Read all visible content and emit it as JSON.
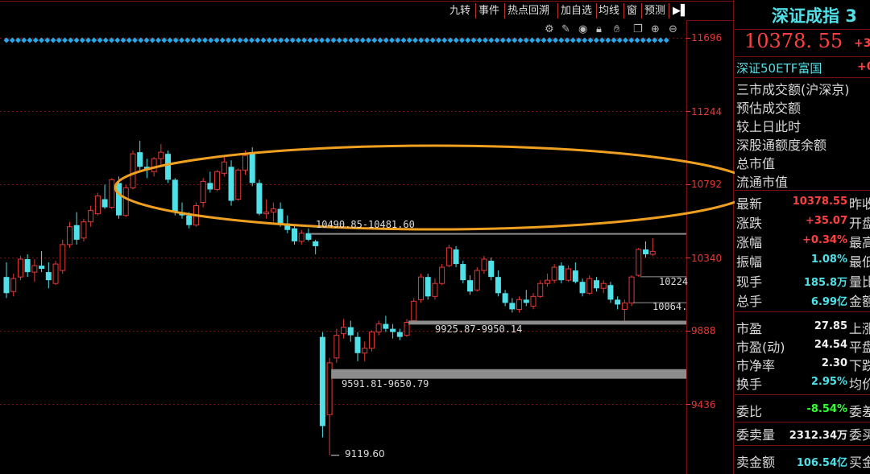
{
  "toolbar": {
    "items": [
      "九转",
      "事件",
      "热点回溯",
      "加自选",
      "均线",
      "窗",
      "预测"
    ],
    "collapse_icon": "collapse-right-icon",
    "icons": [
      "settings-icon",
      "pen-icon",
      "eye-icon",
      "lock-icon",
      "hand-icon",
      "copy-icon",
      "zoom-in-icon",
      "zoom-out-icon"
    ]
  },
  "colors": {
    "up": "#e53935",
    "down": "#4fe0e8",
    "grid": "#7a1111",
    "ellipse": "#f0a020",
    "value_red": "#ff4040",
    "value_green": "#33ff33",
    "value_cyan": "#4fe0e8",
    "title_cyan": "#4fe0e8"
  },
  "chart_data": {
    "type": "candlestick",
    "y_ticks": [
      11696,
      11244,
      10792,
      10340,
      9888,
      9436
    ],
    "ylim": [
      9030,
      11770
    ],
    "grid": true,
    "candles": [
      {
        "o": 10220,
        "h": 10310,
        "l": 10090,
        "c": 10120
      },
      {
        "o": 10130,
        "h": 10240,
        "l": 10100,
        "c": 10210
      },
      {
        "o": 10220,
        "h": 10350,
        "l": 10200,
        "c": 10330
      },
      {
        "o": 10330,
        "h": 10360,
        "l": 10220,
        "c": 10250
      },
      {
        "o": 10250,
        "h": 10330,
        "l": 10190,
        "c": 10290
      },
      {
        "o": 10290,
        "h": 10380,
        "l": 10250,
        "c": 10270
      },
      {
        "o": 10250,
        "h": 10310,
        "l": 10150,
        "c": 10200
      },
      {
        "o": 10180,
        "h": 10320,
        "l": 10170,
        "c": 10300
      },
      {
        "o": 10260,
        "h": 10450,
        "l": 10240,
        "c": 10420
      },
      {
        "o": 10420,
        "h": 10560,
        "l": 10400,
        "c": 10530
      },
      {
        "o": 10540,
        "h": 10620,
        "l": 10420,
        "c": 10450
      },
      {
        "o": 10460,
        "h": 10580,
        "l": 10440,
        "c": 10560
      },
      {
        "o": 10560,
        "h": 10660,
        "l": 10530,
        "c": 10630
      },
      {
        "o": 10610,
        "h": 10740,
        "l": 10600,
        "c": 10720
      },
      {
        "o": 10700,
        "h": 10790,
        "l": 10640,
        "c": 10650
      },
      {
        "o": 10650,
        "h": 10830,
        "l": 10640,
        "c": 10820
      },
      {
        "o": 10800,
        "h": 10840,
        "l": 10580,
        "c": 10600
      },
      {
        "o": 10600,
        "h": 10790,
        "l": 10590,
        "c": 10770
      },
      {
        "o": 10770,
        "h": 11000,
        "l": 10760,
        "c": 10980
      },
      {
        "o": 10990,
        "h": 11060,
        "l": 10880,
        "c": 10900
      },
      {
        "o": 10900,
        "h": 10950,
        "l": 10830,
        "c": 10880
      },
      {
        "o": 10870,
        "h": 10960,
        "l": 10840,
        "c": 10950
      },
      {
        "o": 10950,
        "h": 11040,
        "l": 10910,
        "c": 10990
      },
      {
        "o": 10980,
        "h": 11000,
        "l": 10800,
        "c": 10820
      },
      {
        "o": 10820,
        "h": 10830,
        "l": 10600,
        "c": 10620
      },
      {
        "o": 10620,
        "h": 10680,
        "l": 10580,
        "c": 10600
      },
      {
        "o": 10600,
        "h": 10620,
        "l": 10520,
        "c": 10540
      },
      {
        "o": 10540,
        "h": 10680,
        "l": 10530,
        "c": 10660
      },
      {
        "o": 10680,
        "h": 10830,
        "l": 10650,
        "c": 10810
      },
      {
        "o": 10800,
        "h": 10870,
        "l": 10740,
        "c": 10760
      },
      {
        "o": 10760,
        "h": 10880,
        "l": 10750,
        "c": 10870
      },
      {
        "o": 10860,
        "h": 10960,
        "l": 10840,
        "c": 10930
      },
      {
        "o": 10900,
        "h": 10940,
        "l": 10660,
        "c": 10690
      },
      {
        "o": 10700,
        "h": 10890,
        "l": 10690,
        "c": 10880
      },
      {
        "o": 10880,
        "h": 11000,
        "l": 10850,
        "c": 10970
      },
      {
        "o": 10990,
        "h": 11020,
        "l": 10780,
        "c": 10800
      },
      {
        "o": 10800,
        "h": 10820,
        "l": 10600,
        "c": 10610
      },
      {
        "o": 10610,
        "h": 10700,
        "l": 10580,
        "c": 10620
      },
      {
        "o": 10620,
        "h": 10680,
        "l": 10560,
        "c": 10640
      },
      {
        "o": 10640,
        "h": 10680,
        "l": 10530,
        "c": 10550
      },
      {
        "o": 10550,
        "h": 10600,
        "l": 10490,
        "c": 10510
      },
      {
        "o": 10520,
        "h": 10540,
        "l": 10420,
        "c": 10440
      },
      {
        "o": 10440,
        "h": 10510,
        "l": 10420,
        "c": 10490
      },
      {
        "o": 10490,
        "h": 10520,
        "l": 10440,
        "c": 10450
      },
      {
        "o": 10440,
        "h": 10450,
        "l": 10360,
        "c": 10410
      },
      {
        "o": 9850,
        "h": 9880,
        "l": 9230,
        "c": 9300
      },
      {
        "o": 9370,
        "h": 9720,
        "l": 9120,
        "c": 9690
      },
      {
        "o": 9720,
        "h": 9900,
        "l": 9690,
        "c": 9860
      },
      {
        "o": 9870,
        "h": 9960,
        "l": 9840,
        "c": 9910
      },
      {
        "o": 9910,
        "h": 9950,
        "l": 9820,
        "c": 9860
      },
      {
        "o": 9850,
        "h": 9880,
        "l": 9700,
        "c": 9750
      },
      {
        "o": 9750,
        "h": 9820,
        "l": 9700,
        "c": 9780
      },
      {
        "o": 9780,
        "h": 9890,
        "l": 9760,
        "c": 9880
      },
      {
        "o": 9880,
        "h": 9950,
        "l": 9860,
        "c": 9930
      },
      {
        "o": 9930,
        "h": 9980,
        "l": 9880,
        "c": 9900
      },
      {
        "o": 9900,
        "h": 9930,
        "l": 9840,
        "c": 9880
      },
      {
        "o": 9880,
        "h": 9900,
        "l": 9830,
        "c": 9850
      },
      {
        "o": 9860,
        "h": 9960,
        "l": 9850,
        "c": 9940
      },
      {
        "o": 9950,
        "h": 10090,
        "l": 9940,
        "c": 10070
      },
      {
        "o": 10080,
        "h": 10240,
        "l": 10060,
        "c": 10220
      },
      {
        "o": 10220,
        "h": 10240,
        "l": 10080,
        "c": 10100
      },
      {
        "o": 10100,
        "h": 10210,
        "l": 10080,
        "c": 10180
      },
      {
        "o": 10180,
        "h": 10300,
        "l": 10170,
        "c": 10280
      },
      {
        "o": 10290,
        "h": 10420,
        "l": 10280,
        "c": 10400
      },
      {
        "o": 10390,
        "h": 10410,
        "l": 10280,
        "c": 10300
      },
      {
        "o": 10300,
        "h": 10320,
        "l": 10180,
        "c": 10200
      },
      {
        "o": 10200,
        "h": 10230,
        "l": 10110,
        "c": 10130
      },
      {
        "o": 10140,
        "h": 10280,
        "l": 10130,
        "c": 10260
      },
      {
        "o": 10260,
        "h": 10350,
        "l": 10240,
        "c": 10330
      },
      {
        "o": 10320,
        "h": 10340,
        "l": 10200,
        "c": 10220
      },
      {
        "o": 10220,
        "h": 10260,
        "l": 10100,
        "c": 10120
      },
      {
        "o": 10120,
        "h": 10140,
        "l": 10040,
        "c": 10060
      },
      {
        "o": 10060,
        "h": 10090,
        "l": 10000,
        "c": 10020
      },
      {
        "o": 10020,
        "h": 10100,
        "l": 10000,
        "c": 10080
      },
      {
        "o": 10080,
        "h": 10140,
        "l": 10040,
        "c": 10060
      },
      {
        "o": 10040,
        "h": 10120,
        "l": 10020,
        "c": 10100
      },
      {
        "o": 10100,
        "h": 10200,
        "l": 10090,
        "c": 10180
      },
      {
        "o": 10180,
        "h": 10240,
        "l": 10160,
        "c": 10200
      },
      {
        "o": 10200,
        "h": 10300,
        "l": 10180,
        "c": 10280
      },
      {
        "o": 10290,
        "h": 10310,
        "l": 10180,
        "c": 10200
      },
      {
        "o": 10200,
        "h": 10290,
        "l": 10190,
        "c": 10270
      },
      {
        "o": 10260,
        "h": 10310,
        "l": 10180,
        "c": 10190
      },
      {
        "o": 10190,
        "h": 10210,
        "l": 10100,
        "c": 10120
      },
      {
        "o": 10120,
        "h": 10230,
        "l": 10110,
        "c": 10210
      },
      {
        "o": 10200,
        "h": 10220,
        "l": 10130,
        "c": 10150
      },
      {
        "o": 10150,
        "h": 10200,
        "l": 10120,
        "c": 10180
      },
      {
        "o": 10170,
        "h": 10190,
        "l": 10060,
        "c": 10080
      },
      {
        "o": 10080,
        "h": 10100,
        "l": 10020,
        "c": 10050
      },
      {
        "o": 10020,
        "h": 10080,
        "l": 9935,
        "c": 10060
      },
      {
        "o": 10060,
        "h": 10230,
        "l": 10040,
        "c": 10220
      },
      {
        "o": 10230,
        "h": 10400,
        "l": 10220,
        "c": 10390
      },
      {
        "o": 10390,
        "h": 10440,
        "l": 10340,
        "c": 10360
      },
      {
        "o": 10360,
        "h": 10460,
        "l": 10350,
        "c": 10378
      }
    ],
    "signal_markers": 114,
    "price_labels": [
      {
        "text": "10490.85-10481.60",
        "candle": 43
      },
      {
        "text": "9925.87-9950.14",
        "candle": 57
      },
      {
        "text": "9591.81-9650.79",
        "candle": 46
      },
      {
        "text": "9119.60",
        "candle": 46
      },
      {
        "text": "10224",
        "candle": 90
      },
      {
        "text": "10064.",
        "candle": 89
      }
    ],
    "gaps": [
      {
        "from": 10481.6,
        "to": 10490.85
      },
      {
        "from": 9925.87,
        "to": 9950.14
      },
      {
        "from": 9591.81,
        "to": 9650.79
      }
    ]
  },
  "panel": {
    "title": "深证成指 3",
    "price": "10378. 55",
    "price_change_partial": "+3",
    "etf_name": "深证50ETF富国",
    "etf_change_partial": "+0",
    "info_labels": [
      "三市成交额(沪深京)",
      "预估成交额",
      "较上日此时",
      "深股通额度余额",
      "总市值",
      "流通市值"
    ],
    "rows": [
      {
        "label": "最新",
        "value": "10378.55",
        "right": "昨收",
        "color": "red"
      },
      {
        "label": "涨跌",
        "value": "+35.07",
        "right": "开盘",
        "color": "red"
      },
      {
        "label": "涨幅",
        "value": "+0.34%",
        "right": "最高",
        "color": "red"
      },
      {
        "label": "振幅",
        "value": "1.08%",
        "right": "最低",
        "color": "cyan"
      },
      {
        "label": "现手",
        "value": "185.8万",
        "right": "量比",
        "color": "cyan"
      },
      {
        "label": "总手",
        "value": "6.99亿",
        "right": "金额",
        "color": "cyan"
      },
      {
        "label": "市盈",
        "value": "27.85",
        "right": "上涨",
        "color": "white"
      },
      {
        "label": "市盈(动)",
        "value": "24.54",
        "right": "平盘",
        "color": "white"
      },
      {
        "label": "市净率",
        "value": "2.30",
        "right": "下跌",
        "color": "white"
      },
      {
        "label": "换手",
        "value": "2.95%",
        "right": "均价",
        "color": "cyan"
      },
      {
        "label": "委比",
        "value": "-8.54%",
        "right": "委差",
        "color": "green"
      },
      {
        "label": "委卖量",
        "value": "2312.34万",
        "right": "委买",
        "color": "white"
      },
      {
        "label": "卖金额",
        "value": "106.54亿",
        "right": "买金",
        "color": "cyan"
      }
    ]
  }
}
